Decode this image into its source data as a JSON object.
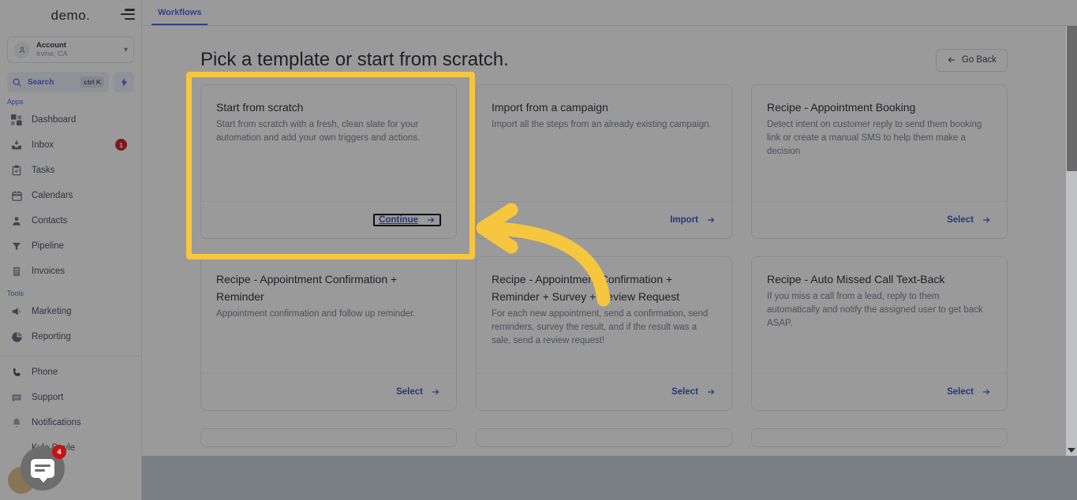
{
  "sidebar": {
    "brand": "demo.",
    "menu_icon": "hamburger-icon",
    "account": {
      "name": "Account",
      "location": "Irvine, CA",
      "avatar_icon": "user-circle-icon",
      "chevron": "chevron-down-icon"
    },
    "search": {
      "label": "Search",
      "shortcut": "ctrl K",
      "icon": "search-icon",
      "quick_action_icon": "bolt-icon"
    },
    "groups": [
      {
        "label": "Apps",
        "items": [
          {
            "label": "Dashboard",
            "icon": "dashboard-grid-icon",
            "badge": ""
          },
          {
            "label": "Inbox",
            "icon": "inbox-icon",
            "badge": "1"
          },
          {
            "label": "Tasks",
            "icon": "tasks-clipboard-icon",
            "badge": ""
          },
          {
            "label": "Calendars",
            "icon": "calendar-icon",
            "badge": ""
          },
          {
            "label": "Contacts",
            "icon": "contacts-person-icon",
            "badge": ""
          },
          {
            "label": "Pipeline",
            "icon": "pipeline-funnel-icon",
            "badge": ""
          },
          {
            "label": "Invoices",
            "icon": "invoice-document-icon",
            "badge": ""
          }
        ]
      },
      {
        "label": "Tools",
        "items": [
          {
            "label": "Marketing",
            "icon": "megaphone-icon",
            "badge": ""
          },
          {
            "label": "Reporting",
            "icon": "pie-chart-icon",
            "badge": ""
          }
        ]
      }
    ],
    "bottom_items": [
      {
        "label": "Phone",
        "icon": "phone-icon",
        "badge": ""
      },
      {
        "label": "Support",
        "icon": "support-chat-icon",
        "badge": ""
      },
      {
        "label": "Notifications",
        "icon": "bell-icon",
        "badge": ""
      },
      {
        "label": "Kyle Doyle",
        "icon": "avatar-icon",
        "badge": ""
      }
    ],
    "chat_widget": {
      "icon": "chat-bubble-icon",
      "badge": "4"
    }
  },
  "tabs": [
    {
      "label": "Workflows",
      "active": true
    }
  ],
  "page": {
    "title": "Pick a template or start from scratch.",
    "go_back": {
      "label": "Go Back",
      "icon": "arrow-left-icon"
    }
  },
  "cards": [
    {
      "title": "Start from scratch",
      "desc": "Start from scratch with a fresh, clean slate for your automation and add your own triggers and actions.",
      "action": "Continue",
      "action_icon": "arrow-right-icon",
      "highlighted": true,
      "focused_action": true
    },
    {
      "title": "Import from a campaign",
      "desc": "Import all the steps from an already existing campaign.",
      "action": "Import",
      "action_icon": "arrow-right-icon",
      "highlighted": false,
      "focused_action": false
    },
    {
      "title": "Recipe - Appointment Booking",
      "desc": "Detect intent on customer reply to send them booking link or create a manual SMS to help them make a decision",
      "action": "Select",
      "action_icon": "arrow-right-icon",
      "highlighted": false,
      "focused_action": false
    },
    {
      "title": "Recipe - Appointment Confirmation + Reminder",
      "desc": "Appointment confirmation and follow up reminder.",
      "action": "Select",
      "action_icon": "arrow-right-icon",
      "highlighted": false,
      "focused_action": false
    },
    {
      "title": "Recipe - Appointment Confirmation + Reminder + Survey + Review Request",
      "desc": "For each new appointment, send a confirmation, send reminders, survey the result, and if the result was a sale, send a review request!",
      "action": "Select",
      "action_icon": "arrow-right-icon",
      "highlighted": false,
      "focused_action": false
    },
    {
      "title": "Recipe - Auto Missed Call Text-Back",
      "desc": "If you miss a call from a lead, reply to them automatically and notify the assigned user to get back ASAP.",
      "action": "Select",
      "action_icon": "arrow-right-icon",
      "highlighted": false,
      "focused_action": false
    }
  ],
  "annotation": {
    "type": "curved-arrow",
    "color": "#f7c63f",
    "points_to": "Start from scratch card Continue action"
  },
  "highlight_color": "#f7c63f",
  "accent_color": "#3b5bdb",
  "scrollbar": {
    "orientation": "vertical",
    "thumb_position_pct": 0
  }
}
